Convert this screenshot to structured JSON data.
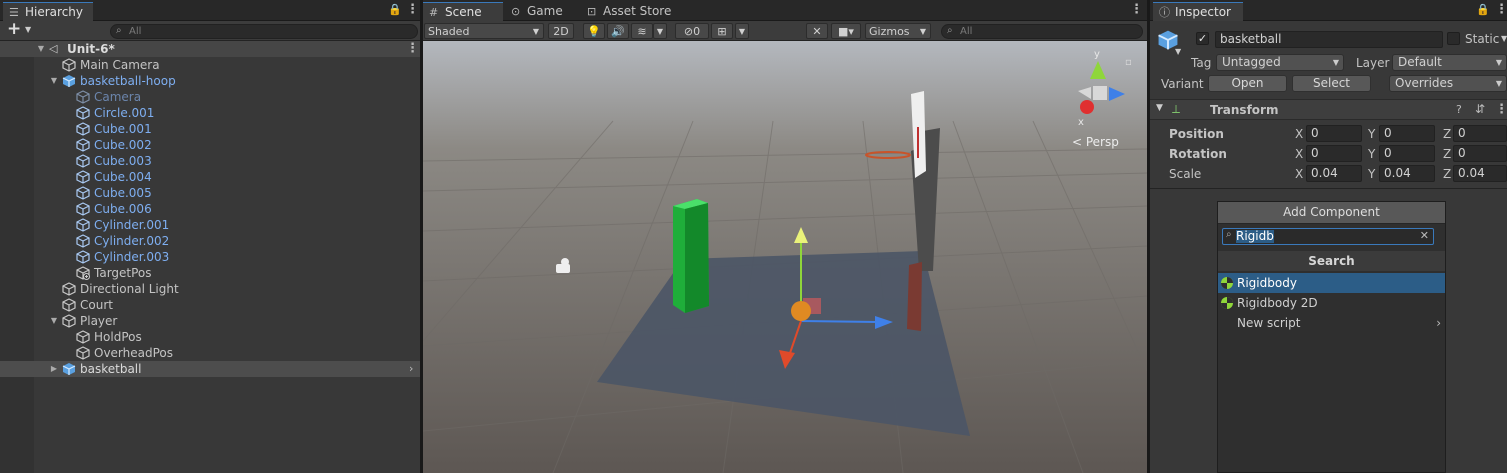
{
  "hierarchy": {
    "tab_label": "Hierarchy",
    "add_label": "+",
    "search_placeholder": "All",
    "scene_name": "Unit-6*",
    "items": [
      {
        "label": "Main Camera"
      },
      {
        "label": "basketball-hoop"
      },
      {
        "label": "Camera"
      },
      {
        "label": "Circle.001"
      },
      {
        "label": "Cube.001"
      },
      {
        "label": "Cube.002"
      },
      {
        "label": "Cube.003"
      },
      {
        "label": "Cube.004"
      },
      {
        "label": "Cube.005"
      },
      {
        "label": "Cube.006"
      },
      {
        "label": "Cylinder.001"
      },
      {
        "label": "Cylinder.002"
      },
      {
        "label": "Cylinder.003"
      },
      {
        "label": "TargetPos"
      },
      {
        "label": "Directional Light"
      },
      {
        "label": "Court"
      },
      {
        "label": "Player"
      },
      {
        "label": "HoldPos"
      },
      {
        "label": "OverheadPos"
      },
      {
        "label": "basketball"
      }
    ]
  },
  "scene": {
    "tabs": [
      {
        "label": "Scene",
        "icon": "hash-icon"
      },
      {
        "label": "Game",
        "icon": "gamepad-icon"
      },
      {
        "label": "Asset Store",
        "icon": "bag-icon"
      }
    ],
    "shading_mode": "Shaded",
    "mode_2d": "2D",
    "hidden_count": "0",
    "gizmos_label": "Gizmos",
    "search_placeholder": "All",
    "persp_label": "< Persp",
    "axis_y": "y",
    "axis_x": "x"
  },
  "inspector": {
    "tab_label": "Inspector",
    "object_name": "basketball",
    "static_label": "Static",
    "tag_label": "Tag",
    "tag_value": "Untagged",
    "layer_label": "Layer",
    "layer_value": "Default",
    "variant_label": "Variant",
    "open_label": "Open",
    "select_label": "Select",
    "overrides_label": "Overrides",
    "transform_label": "Transform",
    "position_label": "Position",
    "rotation_label": "Rotation",
    "scale_label": "Scale",
    "axis_x": "X",
    "axis_y": "Y",
    "axis_z": "Z",
    "position": {
      "x": "0",
      "y": "0",
      "z": "0"
    },
    "rotation": {
      "x": "0",
      "y": "0",
      "z": "0"
    },
    "scale": {
      "x": "0.04",
      "y": "0.04",
      "z": "0.04"
    },
    "add_component_label": "Add Component",
    "component_search_value": "Rigidb",
    "search_header": "Search",
    "results": [
      {
        "label": "Rigidbody"
      },
      {
        "label": "Rigidbody 2D"
      },
      {
        "label": "New script"
      }
    ]
  },
  "colors": {
    "accent_selection": "#2c5d87",
    "prefab_text": "#7eaef0",
    "tab_highlight": "#3a79bb"
  }
}
